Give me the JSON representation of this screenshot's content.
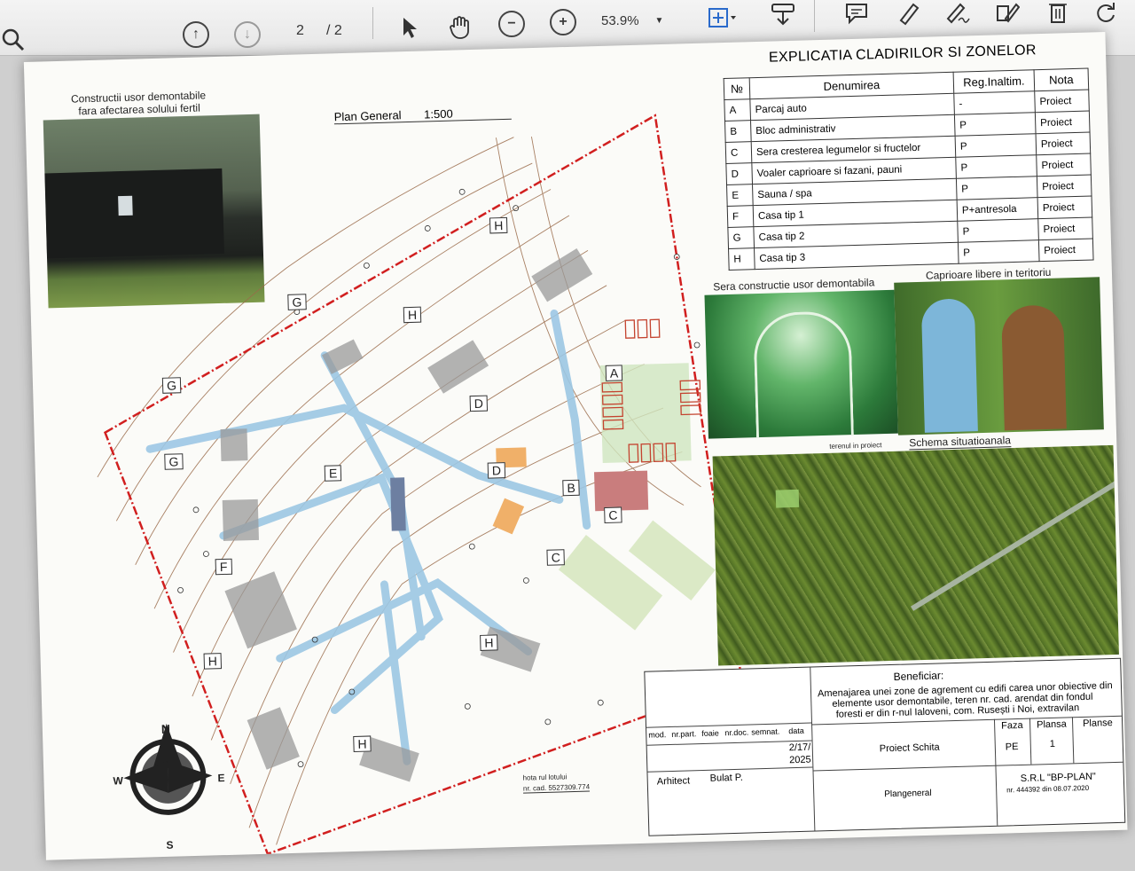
{
  "toolbar": {
    "page_current": "2",
    "page_total": "/ 2",
    "zoom": "53.9%",
    "icons": [
      "search-icon",
      "up-arrow-icon",
      "down-arrow-icon",
      "pointer-icon",
      "hand-icon",
      "zoom-out-icon",
      "zoom-in-icon",
      "fit-page-icon",
      "download-icon",
      "comment-icon",
      "highlight-icon",
      "sign-icon",
      "fill-icon",
      "delete-icon",
      "rotate-icon"
    ]
  },
  "drawing": {
    "photo_caption_1": "Constructii usor demontabile",
    "photo_caption_2": "fara afectarea solului fertil",
    "plan_title": "Plan General",
    "plan_scale": "1:500",
    "legend_title": "EXPLICATIA CLADIRILOR SI ZONELOR",
    "legend_headers": [
      "№",
      "Denumirea",
      "Reg.Inaltim.",
      "Nota"
    ],
    "legend_rows": [
      {
        "id": "A",
        "name": "Parcaj auto",
        "height": "-",
        "note": "Proiect"
      },
      {
        "id": "B",
        "name": "Bloc administrativ",
        "height": "P",
        "note": "Proiect"
      },
      {
        "id": "C",
        "name": "Sera cresterea legumelor si fructelor",
        "height": "P",
        "note": "Proiect"
      },
      {
        "id": "D",
        "name": "Voaler caprioare si fazani, pauni",
        "height": "P",
        "note": "Proiect"
      },
      {
        "id": "E",
        "name": "Sauna / spa",
        "height": "P",
        "note": "Proiect"
      },
      {
        "id": "F",
        "name": "Casa tip 1",
        "height": "P+antresola",
        "note": "Proiect"
      },
      {
        "id": "G",
        "name": "Casa tip 2",
        "height": "P",
        "note": "Proiect"
      },
      {
        "id": "H",
        "name": "Casa tip 3",
        "height": "P",
        "note": "Proiect"
      }
    ],
    "greenhouse_caption": "Sera constructie usor demontabila",
    "deer_caption": "Caprioare libere in teritoriu",
    "scheme_note": "terenul in proiect",
    "scheme_title": "Schema situatioanala",
    "plot_note_1": "hota rul lotului",
    "plot_note_2": "nr. cad. 5527309.774",
    "compass": {
      "n": "N",
      "s": "S",
      "e": "E",
      "w": "W"
    },
    "map_labels": [
      "A",
      "B",
      "C",
      "C",
      "D",
      "D",
      "E",
      "F",
      "G",
      "G",
      "G",
      "H",
      "H",
      "H",
      "H",
      "H"
    ]
  },
  "title_block": {
    "beneficiary_label": "Beneficiar:",
    "description_1": "Amenajarea unei zone de agrement cu edifi carea unor obiective din",
    "description_2": "elemente usor demontabile, teren nr. cad.  arendat din fondul",
    "description_3": "foresti er din r-nul Ialoveni, com. Rusești i    Noi,   extravilan",
    "cols": [
      "mod.",
      "nr.part.",
      "foaie",
      "nr.doc.",
      "semnat.",
      "data"
    ],
    "date_1": "2/17/",
    "date_2": "2025",
    "architect_label": "Arhitect",
    "architect_name": "Bulat P.",
    "project": "Proiect Schita",
    "sheet_name": "Plangeneral",
    "phase_label": "Faza",
    "phase": "PE",
    "plansa_label": "Plansa",
    "plansa": "1",
    "planse_label": "Planse",
    "company": "S.R.L \"BP-PLAN\"",
    "company_license": "nr. 444392 din 08.07.2020"
  }
}
